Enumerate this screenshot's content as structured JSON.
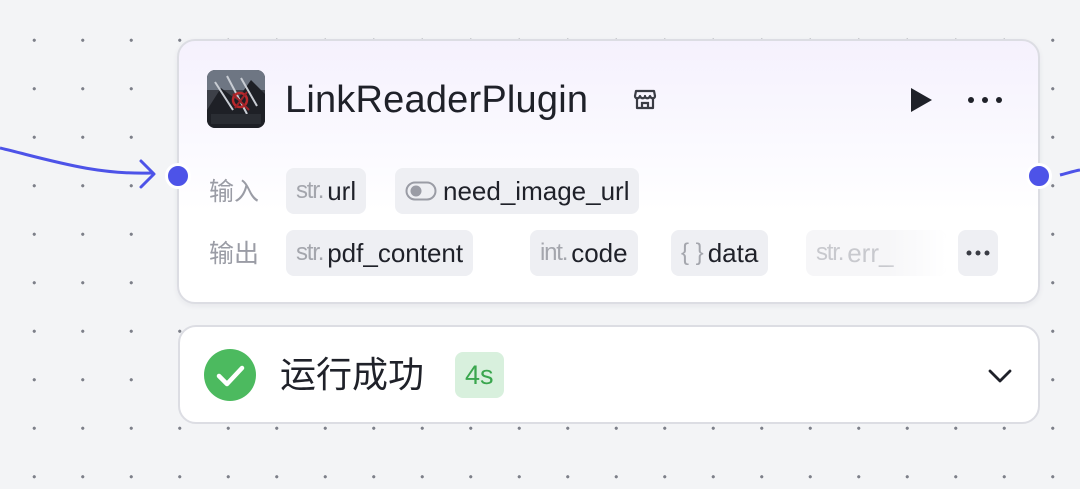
{
  "node": {
    "title": "LinkReaderPlugin",
    "avatar_icon": "plugin-avatar-image",
    "store_icon": "store-icon",
    "run_icon": "play-icon",
    "more_icon": "more-horizontal-icon",
    "accent_color": "#4d53e8",
    "inputs_label": "输入",
    "outputs_label": "输出",
    "inputs": [
      {
        "type": "str.",
        "name": "url"
      },
      {
        "type": "toggle-icon",
        "name": "need_image_url"
      }
    ],
    "outputs": [
      {
        "type": "str.",
        "name": "pdf_content"
      },
      {
        "type": "int.",
        "name": "code"
      },
      {
        "type": "{ }",
        "name": "data"
      },
      {
        "type": "str.",
        "name": "err_"
      }
    ],
    "overflow_icon": "more-horizontal-icon"
  },
  "status": {
    "icon": "check-circle-icon",
    "text": "运行成功",
    "duration": "4s",
    "success_color": "#4cba5f",
    "expand_icon": "chevron-down-icon"
  }
}
